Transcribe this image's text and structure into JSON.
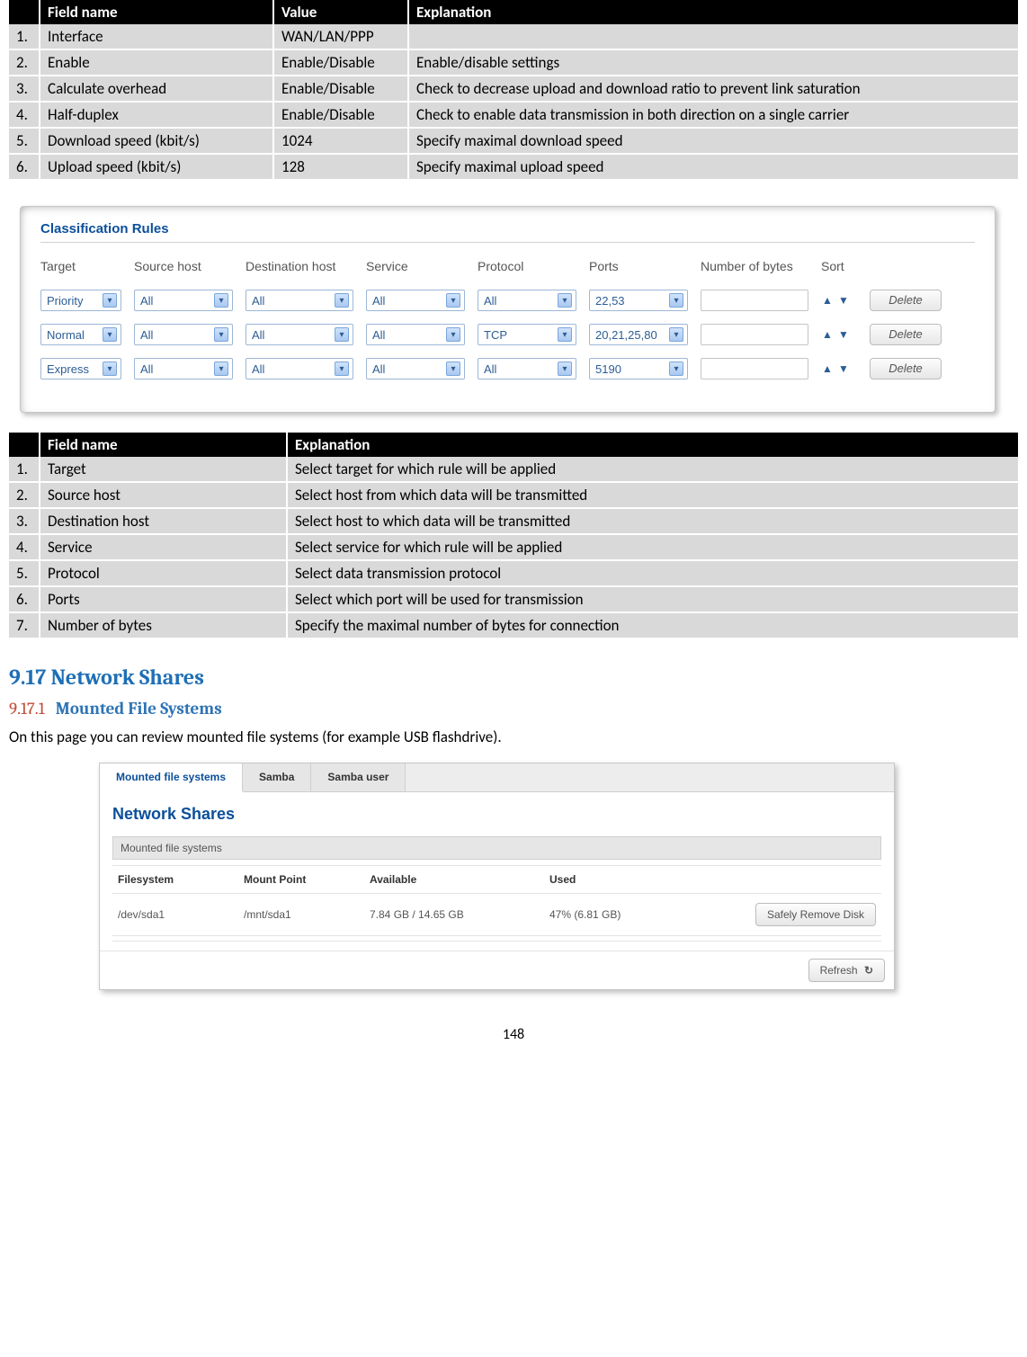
{
  "table1": {
    "headers": {
      "num": "",
      "field": "Field name",
      "value": "Value",
      "expl": "Explanation"
    },
    "rows": [
      {
        "n": "1.",
        "field": "Interface",
        "value": "WAN/LAN/PPP",
        "expl": ""
      },
      {
        "n": "2.",
        "field": "Enable",
        "value": "Enable/Disable",
        "expl": "Enable/disable settings"
      },
      {
        "n": "3.",
        "field": "Calculate overhead",
        "value": "Enable/Disable",
        "expl": "Check to decrease upload and download ratio to prevent link saturation"
      },
      {
        "n": "4.",
        "field": "Half-duplex",
        "value": "Enable/Disable",
        "expl": "Check to enable data transmission in both direction on a single carrier"
      },
      {
        "n": "5.",
        "field": "Download speed (kbit/s)",
        "value": "1024",
        "expl": "Specify maximal download speed"
      },
      {
        "n": "6.",
        "field": "Upload speed (kbit/s)",
        "value": "128",
        "expl": "Specify maximal upload speed"
      }
    ]
  },
  "rules": {
    "title": "Classification Rules",
    "headers": {
      "target": "Target",
      "shost": "Source host",
      "dhost": "Destination host",
      "service": "Service",
      "protocol": "Protocol",
      "ports": "Ports",
      "bytes": "Number of bytes",
      "sort": "Sort"
    },
    "rows": [
      {
        "target": "Priority",
        "shost": "All",
        "dhost": "All",
        "service": "All",
        "protocol": "All",
        "ports": "22,53",
        "bytes": ""
      },
      {
        "target": "Normal",
        "shost": "All",
        "dhost": "All",
        "service": "All",
        "protocol": "TCP",
        "ports": "20,21,25,80",
        "bytes": ""
      },
      {
        "target": "Express",
        "shost": "All",
        "dhost": "All",
        "service": "All",
        "protocol": "All",
        "ports": "5190",
        "bytes": ""
      }
    ],
    "deleteLabel": "Delete"
  },
  "table2": {
    "headers": {
      "num": "",
      "field": "Field name",
      "expl": "Explanation"
    },
    "rows": [
      {
        "n": "1.",
        "field": "Target",
        "expl": "Select target for which rule will be applied"
      },
      {
        "n": "2.",
        "field": "Source host",
        "expl": "Select host from which data will be transmitted"
      },
      {
        "n": "3.",
        "field": "Destination host",
        "expl": "Select host to which data will be transmitted"
      },
      {
        "n": "4.",
        "field": "Service",
        "expl": "Select service for which rule will be applied"
      },
      {
        "n": "5.",
        "field": "Protocol",
        "expl": "Select data transmission protocol"
      },
      {
        "n": "6.",
        "field": "Ports",
        "expl": "Select which port will be used for transmission"
      },
      {
        "n": "7.",
        "field": "Number of bytes",
        "expl": "Specify the maximal number of bytes for connection"
      }
    ]
  },
  "section": {
    "heading": "9.17 Network Shares",
    "sub_num": "9.17.1",
    "sub_txt": "Mounted File Systems",
    "body": "On this page you can review mounted file systems (for example USB flashdrive)."
  },
  "ns": {
    "tabs": [
      "Mounted file systems",
      "Samba",
      "Samba user"
    ],
    "title": "Network Shares",
    "sectionLabel": "Mounted file systems",
    "cols": {
      "fs": "Filesystem",
      "mp": "Mount Point",
      "av": "Available",
      "used": "Used"
    },
    "row": {
      "fs": "/dev/sda1",
      "mp": "/mnt/sda1",
      "av": "7.84 GB / 14.65 GB",
      "used": "47% (6.81 GB)"
    },
    "removeBtn": "Safely Remove Disk",
    "refreshBtn": "Refresh"
  },
  "pageNumber": "148"
}
